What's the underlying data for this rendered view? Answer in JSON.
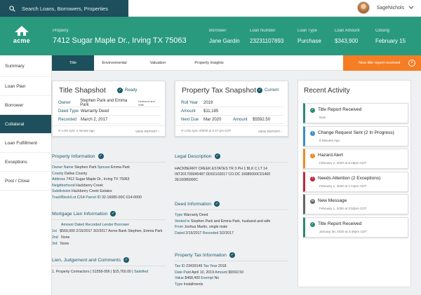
{
  "search": {
    "placeholder": "Search Loans, Borrowers, Properties"
  },
  "user": {
    "name": "SageNichols"
  },
  "logo": {
    "text": "acme"
  },
  "header": {
    "property_label": "Property",
    "property_value": "7412 Sugar Maple Dr., Irving TX 75063",
    "fields": [
      {
        "label": "Borrower",
        "value": "Jane Gardin"
      },
      {
        "label": "Loan Number",
        "value": "23231107893"
      },
      {
        "label": "Loan Type",
        "value": "Purchase"
      },
      {
        "label": "Loan Amount",
        "value": "$343,900"
      },
      {
        "label": "Closing",
        "value": "February 15"
      }
    ]
  },
  "sidebar": {
    "items": [
      "Summary",
      "Loan Plan",
      "Borrower",
      "Collateral",
      "Loan Fulfillment",
      "Exceptions",
      "Post / Close"
    ]
  },
  "tabs": [
    "Title",
    "Environmental",
    "Valuation",
    "Property Insights"
  ],
  "alert_button": {
    "label": "New title report received",
    "close": "×"
  },
  "title_card": {
    "title": "Title Shapshot",
    "status": "Ready",
    "rows": [
      {
        "label": "Owner",
        "value": "Stephen Park and Emma Park",
        "note": "Husband and Wife"
      },
      {
        "label": "Deed Type",
        "value": "Warranty Deed"
      },
      {
        "label": "Recorded",
        "value": "March 2, 2017"
      }
    ],
    "sync": "LOS sync 1 minute ago",
    "view": "VIEW REPORT"
  },
  "tax_card": {
    "title": "Property Tax Snapshot",
    "status": "Current",
    "rows": [
      {
        "label": "Roll Year",
        "value": "2019"
      },
      {
        "label": "Amount",
        "value": "$11,185"
      },
      {
        "label": "Next Due",
        "value": "Mar 2020",
        "label2": "Amount",
        "value2": "$5592.50"
      }
    ],
    "sync": "LOS sync 2/5/20 at 2:47 pm CDT",
    "view": "VIEW REPORT"
  },
  "property_info": {
    "title": "Property Information",
    "lines": [
      [
        [
          "k",
          "Owner Name "
        ],
        [
          "v",
          "Stephen Park"
        ],
        [
          "k",
          " Spouse "
        ],
        [
          "v",
          "Emma Park"
        ]
      ],
      [
        [
          "k",
          "County "
        ],
        [
          "v",
          "Dallas County"
        ]
      ],
      [
        [
          "k",
          "Address "
        ],
        [
          "v",
          "7412 Sugar Maple Dr., Irving TX 75063"
        ]
      ],
      [
        [
          "k",
          "Neighborhood "
        ],
        [
          "v",
          "Hackberry Creek"
        ]
      ],
      [
        [
          "k",
          "Subdivision "
        ],
        [
          "v",
          "Hackberry Creek Estates"
        ]
      ],
      [
        [
          "k",
          "Tract/Block/Lot "
        ],
        [
          "v",
          "C/14"
        ],
        [
          "k",
          " Parcel ID "
        ],
        [
          "v",
          "32-16085-00C-014-0000"
        ]
      ]
    ]
  },
  "mortgage_info": {
    "title": "Mortgage Lien Information",
    "header": "Amount Dated Recorded Lender Borrower",
    "rows": [
      {
        "label": "1st",
        "value": "$569,000 2/15/2017 3/2/2017 Acme Bank Stephen, Emma Park"
      },
      {
        "label": "2nd",
        "value": "None"
      },
      {
        "label": "3rd",
        "value": "None"
      }
    ]
  },
  "liens": {
    "title": "Lien, Judgement and Comments",
    "line": "1. Property Contractors | 51558-056 | $15,760.00 | ",
    "status": "Satisfied"
  },
  "legal": {
    "title": "Legal Description",
    "lines": [
      "HACKBERRY CREEK ESTATES TR 3 PH 1 BLK C LT 14",
      "INT201700045487 DD02102017 CO-DC 16085000C01400",
      "2E16085000C"
    ]
  },
  "deed": {
    "title": "Deed Information",
    "lines": [
      [
        [
          "k",
          "Type "
        ],
        [
          "v",
          "Warranty Deed"
        ]
      ],
      [
        [
          "k",
          "Vested in "
        ],
        [
          "v",
          "Stephen Park and Emma Park, husband and wife"
        ]
      ],
      [
        [
          "k",
          "From "
        ],
        [
          "v",
          "Joshua Martin, single male"
        ]
      ],
      [
        [
          "k",
          "Dated "
        ],
        [
          "v",
          "2/15/2017"
        ],
        [
          "k",
          " Recorded "
        ],
        [
          "v",
          "3/2/2017"
        ]
      ]
    ]
  },
  "tax_info": {
    "title": "Property Tax Information",
    "lines": [
      [
        [
          "k",
          "Tax ID "
        ],
        [
          "v",
          "23439149"
        ],
        [
          "k",
          " Tax Year "
        ],
        [
          "v",
          "2018"
        ]
      ],
      [
        [
          "k",
          "Date Paid "
        ],
        [
          "v",
          "April 10, 2019"
        ],
        [
          "k",
          " Amount "
        ],
        [
          "v",
          "$5592.50"
        ]
      ],
      [
        [
          "k",
          "Value "
        ],
        [
          "v",
          "$468,400"
        ],
        [
          "k",
          " Exempt "
        ],
        [
          "v",
          "No"
        ]
      ],
      [
        [
          "k",
          "Type "
        ],
        [
          "v",
          "Installments"
        ]
      ]
    ]
  },
  "activity": {
    "title": "Recent Activity",
    "items": [
      {
        "title": "Title Report Received",
        "date": "Now",
        "color": "#2a8a7a",
        "icon": "✓"
      },
      {
        "title": "Change Request Sent (2 In Progress)",
        "date": "8 Minutes Ago",
        "color": "#3a8ed0",
        "icon": "i"
      },
      {
        "title": "Hazard Alert",
        "date": "February 2, 2020 at 8:19pm CDT",
        "color": "#f08a24",
        "icon": "!"
      },
      {
        "title": "Needs Attention (2 Exceptions)",
        "date": "February 1, 2020 at 1:14pm CDT",
        "color": "#c0283a",
        "icon": "!"
      },
      {
        "title": "New Message",
        "date": "February 1, 2020 at 3:52pm CDT",
        "color": "#666666",
        "icon": "✉"
      },
      {
        "title": "Title Report Received",
        "date": "January 30, 2020 at 3:49pm CDT",
        "color": "#2a8a7a",
        "icon": "✓"
      }
    ]
  }
}
